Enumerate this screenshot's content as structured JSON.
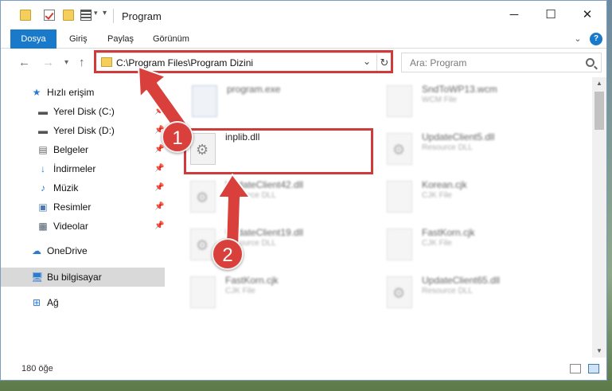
{
  "window": {
    "title": "Program"
  },
  "ribbon": {
    "tabs": [
      {
        "label": "Dosya",
        "active": true
      },
      {
        "label": "Giriş"
      },
      {
        "label": "Paylaş"
      },
      {
        "label": "Görünüm"
      }
    ],
    "help_label": "?"
  },
  "address": {
    "path": "C:\\Program Files\\Program Dizini"
  },
  "search": {
    "placeholder": "Ara: Program"
  },
  "sidebar": {
    "items": [
      {
        "label": "Hızlı erişim",
        "icon": "star-icon"
      },
      {
        "label": "Yerel Disk (C:)",
        "icon": "drive-icon"
      },
      {
        "label": "Yerel Disk (D:)",
        "icon": "drive-icon"
      },
      {
        "label": "Belgeler",
        "icon": "documents-icon"
      },
      {
        "label": "İndirmeler",
        "icon": "download-icon"
      },
      {
        "label": "Müzik",
        "icon": "music-icon"
      },
      {
        "label": "Resimler",
        "icon": "pictures-icon"
      },
      {
        "label": "Videolar",
        "icon": "videos-icon"
      },
      {
        "label": "OneDrive",
        "icon": "cloud-icon"
      },
      {
        "label": "Bu bilgisayar",
        "icon": "computer-icon",
        "selected": true
      },
      {
        "label": "Ağ",
        "icon": "network-icon"
      }
    ]
  },
  "files": [
    {
      "name": "program.exe",
      "type": "",
      "kind": "exe"
    },
    {
      "name": "SndToWP13.wcm",
      "type": "WCM File",
      "kind": "file"
    },
    {
      "name": "inplib.dll",
      "type": "",
      "kind": "dll"
    },
    {
      "name": "UpdateClient5.dll",
      "type": "Resource DLL",
      "kind": "dll"
    },
    {
      "name": "UpdateClient42.dll",
      "type": "Resource DLL",
      "kind": "dll"
    },
    {
      "name": "Korean.cjk",
      "type": "CJK File",
      "kind": "file"
    },
    {
      "name": "UpdateClient19.dll",
      "type": "Resource DLL",
      "kind": "dll"
    },
    {
      "name": "FastKorn.cjk",
      "type": "CJK File",
      "kind": "file"
    },
    {
      "name": "FastKorn.cjk",
      "type": "CJK File",
      "kind": "file"
    },
    {
      "name": "UpdateClient65.dll",
      "type": "Resource DLL",
      "kind": "dll"
    }
  ],
  "status": {
    "item_count": "180 öğe"
  },
  "callouts": [
    "1",
    "2"
  ],
  "colors": {
    "accent": "#1979ca",
    "highlight": "#d13a3a",
    "badge": "#d9403c"
  }
}
